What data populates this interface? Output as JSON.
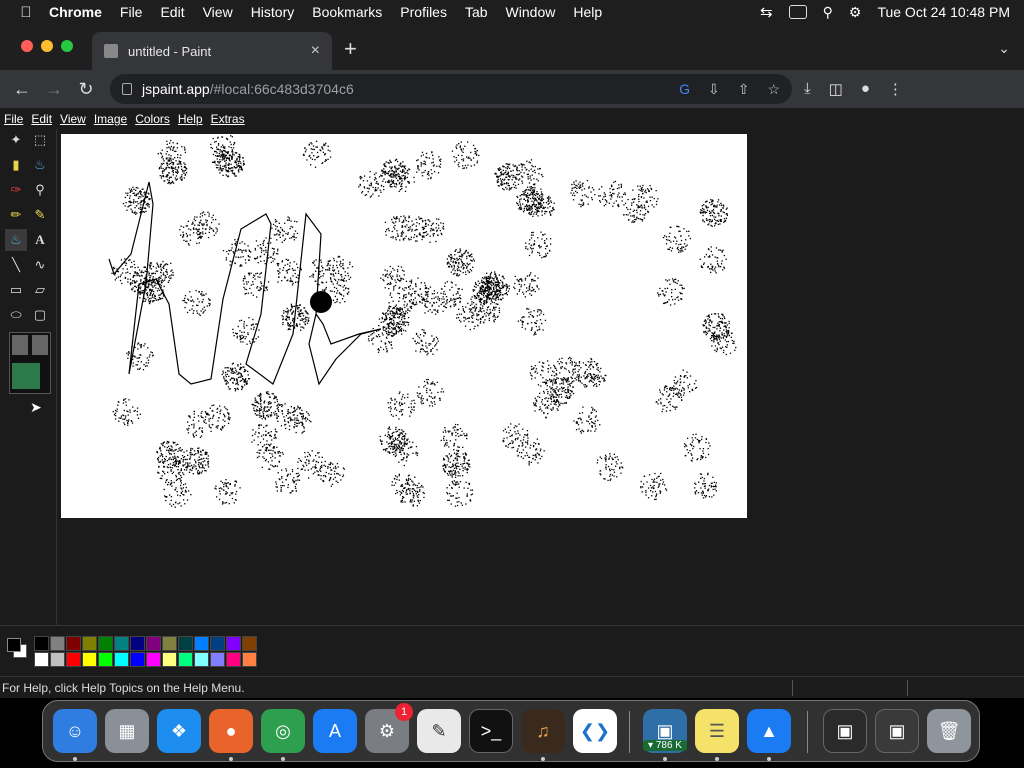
{
  "menubar": {
    "apple_icon": "apple-icon",
    "app_name": "Chrome",
    "items": [
      "File",
      "Edit",
      "View",
      "History",
      "Bookmarks",
      "Profiles",
      "Tab",
      "Window",
      "Help"
    ],
    "datetime": "Tue Oct 24  10:48 PM"
  },
  "browser": {
    "tab_title": "untitled - Paint",
    "url_host": "jspaint.app",
    "url_path": "/#local:66c483d3704c6"
  },
  "paint": {
    "menu": [
      "File",
      "Edit",
      "View",
      "Image",
      "Colors",
      "Help",
      "Extras"
    ],
    "tools": [
      "free-form-select",
      "select",
      "eraser",
      "fill-with-color",
      "pick-color",
      "magnifier",
      "pencil",
      "brush",
      "airbrush",
      "text",
      "line",
      "curve",
      "rectangle",
      "polygon",
      "ellipse",
      "rounded-rectangle"
    ],
    "active_tool": "airbrush",
    "status_text": "For Help, click Help Topics on the Help Menu.",
    "foreground_color": "#000000",
    "background_color": "#ffffff",
    "palette_top": [
      "#000000",
      "#808080",
      "#800000",
      "#808000",
      "#008000",
      "#008080",
      "#000080",
      "#800080",
      "#808040",
      "#004040",
      "#0080ff",
      "#004080",
      "#8000ff",
      "#804000"
    ],
    "palette_bottom": [
      "#ffffff",
      "#c0c0c0",
      "#ff0000",
      "#ffff00",
      "#00ff00",
      "#00ffff",
      "#0000ff",
      "#ff00ff",
      "#ffff80",
      "#00ff80",
      "#80ffff",
      "#8080ff",
      "#ff0080",
      "#ff8040"
    ]
  },
  "dock": {
    "apps": [
      "Finder",
      "Launchpad",
      "Safari",
      "Firefox",
      "Chrome",
      "App Store",
      "System Settings",
      "TextEdit",
      "Terminal",
      "GarageBand",
      "Visual Studio Code",
      "Network Monitor",
      "Notes",
      "Keynote",
      "Downloads",
      "Screenshots",
      "Trash"
    ],
    "settings_badge": "1",
    "net_badge": "▾ 786 K"
  }
}
